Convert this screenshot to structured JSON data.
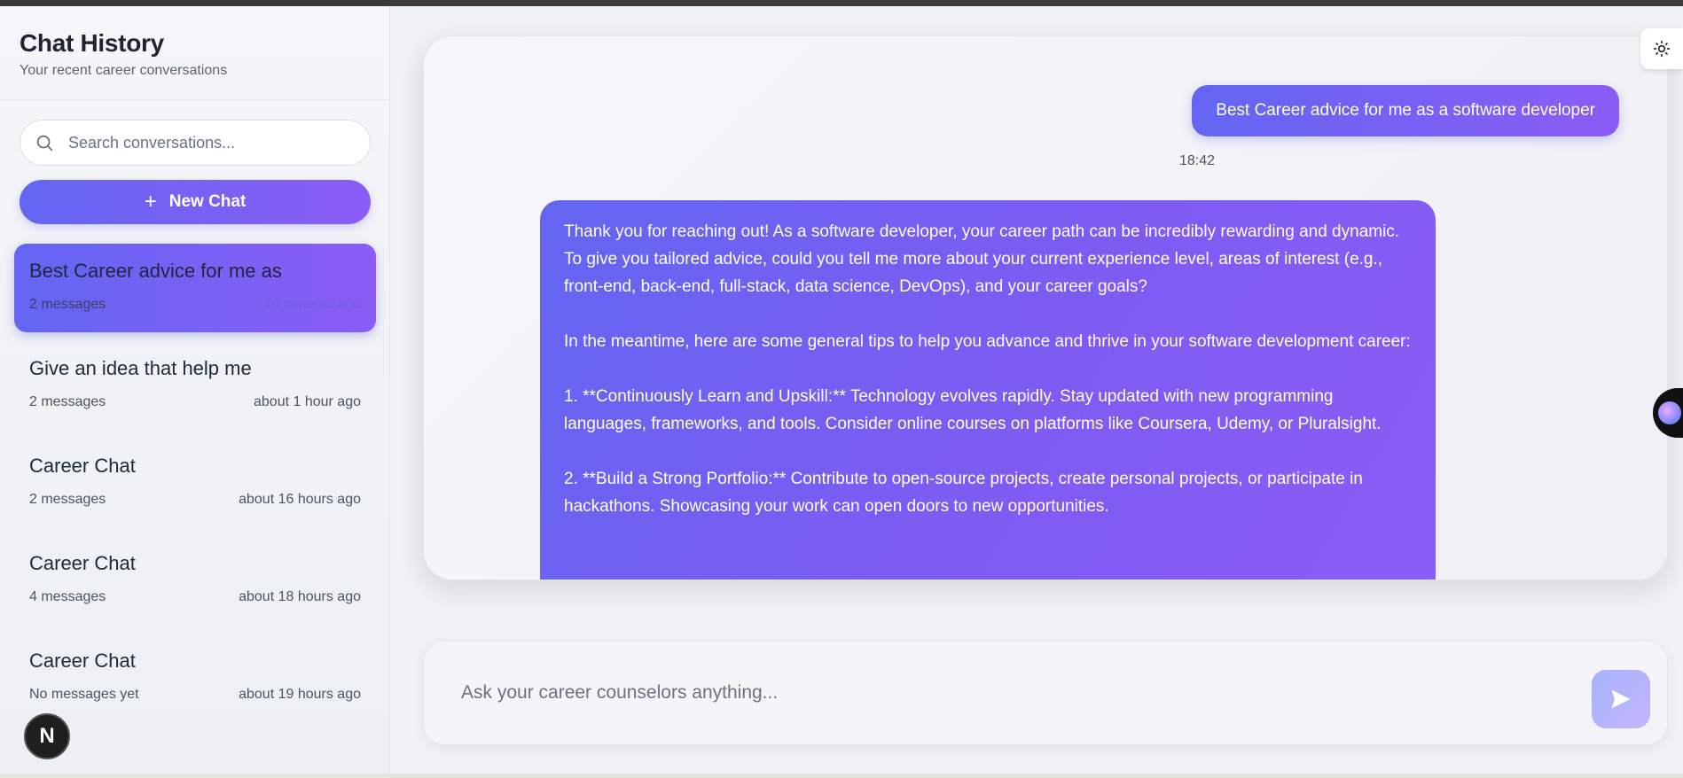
{
  "sidebar": {
    "title": "Chat History",
    "subtitle": "Your recent career conversations",
    "search_placeholder": "Search conversations...",
    "new_chat_label": "New Chat",
    "conversations": [
      {
        "title": "Best Career advice for me as",
        "count": "2 messages",
        "time": "10 minutes ago",
        "active": true
      },
      {
        "title": "Give an idea that help me",
        "count": "2 messages",
        "time": "about 1 hour ago"
      },
      {
        "title": "Career Chat",
        "count": "2 messages",
        "time": "about 16 hours ago"
      },
      {
        "title": "Career Chat",
        "count": "4 messages",
        "time": "about 18 hours ago"
      },
      {
        "title": "Career Chat",
        "count": "No messages yet",
        "time": "about 19 hours ago"
      }
    ]
  },
  "badge": {
    "label": "N"
  },
  "chat": {
    "user_message": "Best Career advice for me as a software developer",
    "user_time": "18:42",
    "bot_paragraphs": [
      "Thank you for reaching out! As a software developer, your career path can be incredibly rewarding and dynamic. To give you tailored advice, could you tell me more about your current experience level, areas of interest (e.g., front-end, back-end, full-stack, data science, DevOps), and your career goals?",
      "In the meantime, here are some general tips to help you advance and thrive in your software development career:",
      "1. **Continuously Learn and Upskill:** Technology evolves rapidly. Stay updated with new programming languages, frameworks, and tools. Consider online courses on platforms like Coursera, Udemy, or Pluralsight.",
      "2. **Build a Strong Portfolio:** Contribute to open-source projects, create personal projects, or participate in hackathons. Showcasing your work can open doors to new opportunities."
    ]
  },
  "composer": {
    "placeholder": "Ask your career counselors anything..."
  },
  "icons": {
    "search": "search-icon",
    "plus": "plus-icon",
    "theme": "sun-icon",
    "send": "send-icon"
  },
  "colors": {
    "accent_start": "#6366f1",
    "accent_end": "#8b5cf6"
  }
}
